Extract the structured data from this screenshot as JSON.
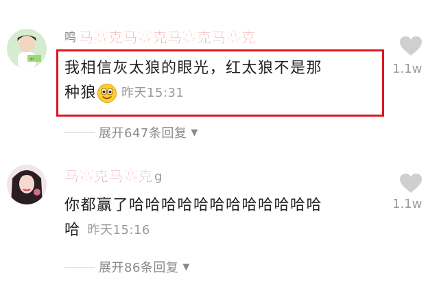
{
  "comments": [
    {
      "username_visible": "鸣",
      "username_mask": "马赛克马赛克马赛克马赛克",
      "text_line1": "我相信灰太狼的眼光，红太狼不是那",
      "text_line2": "种狼",
      "time": "昨天15:31",
      "like_count": "1.1w",
      "expand_label": "展开647条回复",
      "expand_arrow": "▼"
    },
    {
      "username_mask": "马赛克马赛克",
      "username_trail": "g",
      "text_line1": "你都赢了哈哈哈哈哈哈哈哈哈哈哈哈",
      "text_line2": "哈",
      "time": "昨天15:16",
      "like_count": "1.1w",
      "expand_label": "展开86条回复",
      "expand_arrow": "▼"
    }
  ],
  "colors": {
    "mask_red": "#e0181f",
    "highlight_box": "#e0141d",
    "meta_gray": "#9a9a9a",
    "heart_gray": "#cfcfcf"
  },
  "icons": [
    "heart-icon",
    "chevron-down-icon",
    "smiley-emoji-icon"
  ]
}
